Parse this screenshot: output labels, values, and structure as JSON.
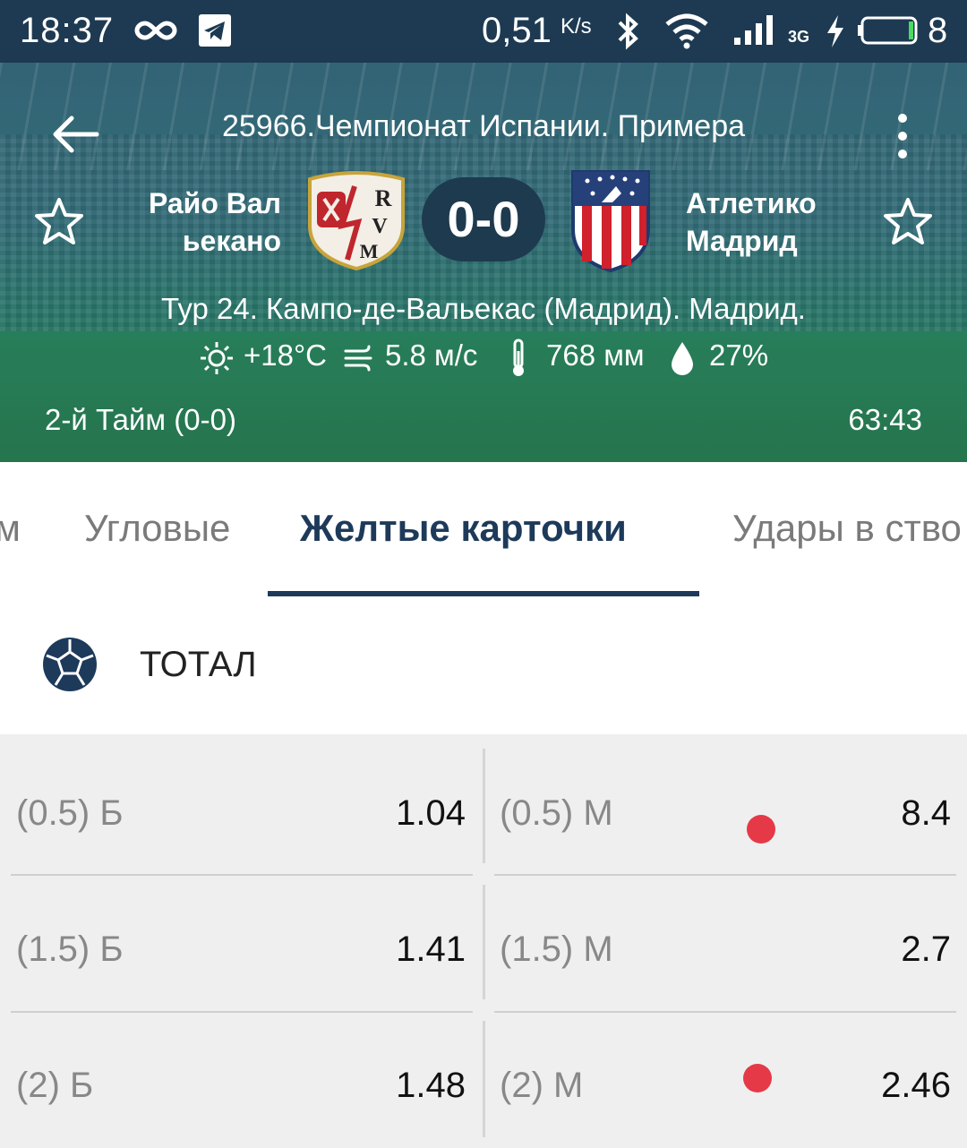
{
  "status_bar": {
    "time": "18:37",
    "net_speed": "0,51",
    "net_speed_unit": "K/s",
    "network_type": "3G",
    "battery_level": "8",
    "icons": [
      "infinity-icon",
      "telegram-icon",
      "bluetooth-icon",
      "wifi-icon",
      "signal-icon",
      "charging-icon",
      "battery-icon"
    ]
  },
  "header": {
    "league": "25966.Чемпионат Испании. Примера",
    "home_team": {
      "line1": "Райо Вал",
      "line2": "ьекано"
    },
    "away_team": {
      "line1": "Атлетико",
      "line2": "Мадрид"
    },
    "score": "0-0",
    "venue": "Тур 24. Кампо-де-Вальекас (Мадрид). Мадрид.",
    "weather": {
      "temperature": "+18°C",
      "wind": "5.8 м/с",
      "pressure": "768 мм",
      "humidity": "27%"
    },
    "period": "2-й  Тайм (0-0)",
    "clock": "63:43"
  },
  "tabs": [
    {
      "label": "м",
      "active": false
    },
    {
      "label": "Угловые",
      "active": false
    },
    {
      "label": "Желтые карточки",
      "active": true
    },
    {
      "label": "Удары в ство",
      "active": false
    }
  ],
  "market": {
    "title": "ТОТАЛ"
  },
  "odds": [
    {
      "over_label": "(0.5) Б",
      "over_value": "1.04",
      "under_label": "(0.5) М",
      "under_value": "8.4",
      "under_dot": true
    },
    {
      "over_label": "(1.5) Б",
      "over_value": "1.41",
      "under_label": "(1.5) М",
      "under_value": "2.7",
      "under_dot": false
    },
    {
      "over_label": "(2) Б",
      "over_value": "1.48",
      "under_label": "(2) М",
      "under_value": "2.46",
      "under_dot": true
    }
  ],
  "colors": {
    "status_bar": "#1d3a52",
    "accent": "#1d3a5a",
    "indicator_dot": "#e53947"
  }
}
